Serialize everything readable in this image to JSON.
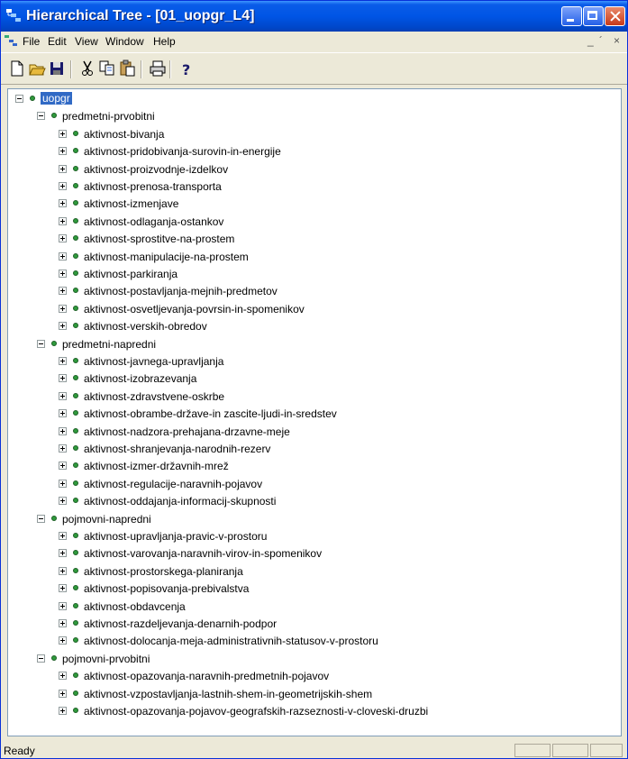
{
  "window": {
    "title": "Hierarchical Tree - [01_uopgr_L4]"
  },
  "menu": [
    "File",
    "Edit",
    "View",
    "Window",
    "Help"
  ],
  "mdi_controls": {
    "min": "_",
    "restore": "´",
    "close": "×"
  },
  "toolbar": [
    {
      "name": "new-icon",
      "icon": "new"
    },
    {
      "name": "open-icon",
      "icon": "open"
    },
    {
      "name": "save-icon",
      "icon": "save"
    },
    {
      "name": "cut-icon",
      "icon": "cut"
    },
    {
      "name": "copy-icon",
      "icon": "copy"
    },
    {
      "name": "paste-icon",
      "icon": "paste"
    },
    {
      "name": "print-icon",
      "icon": "print"
    },
    {
      "name": "help-icon",
      "icon": "help"
    }
  ],
  "tree": {
    "root": "uopgr",
    "groups": [
      {
        "label": "predmetni-prvobitni",
        "children": [
          "aktivnost-bivanja",
          "aktivnost-pridobivanja-surovin-in-energije",
          "aktivnost-proizvodnje-izdelkov",
          "aktivnost-prenosa-transporta",
          "aktivnost-izmenjave",
          "aktivnost-odlaganja-ostankov",
          "aktivnost-sprostitve-na-prostem",
          "aktivnost-manipulacije-na-prostem",
          "aktivnost-parkiranja",
          "aktivnost-postavljanja-mejnih-predmetov",
          "aktivnost-osvetljevanja-povrsin-in-spomenikov",
          "aktivnost-verskih-obredov"
        ]
      },
      {
        "label": "predmetni-napredni",
        "children": [
          "aktivnost-javnega-upravljanja",
          "aktivnost-izobrazevanja",
          "aktivnost-zdravstvene-oskrbe",
          "aktivnost-obrambe-države-in zascite-ljudi-in-sredstev",
          "aktivnost-nadzora-prehajana-drzavne-meje",
          "aktivnost-shranjevanja-narodnih-rezerv",
          "aktivnost-izmer-državnih-mrež",
          "aktivnost-regulacije-naravnih-pojavov",
          "aktivnost-oddajanja-informacij-skupnosti"
        ]
      },
      {
        "label": "pojmovni-napredni",
        "children": [
          "aktivnost-upravljanja-pravic-v-prostoru",
          "aktivnost-varovanja-naravnih-virov-in-spomenikov",
          "aktivnost-prostorskega-planiranja",
          "aktivnost-popisovanja-prebivalstva",
          "aktivnost-obdavcenja",
          "aktivnost-razdeljevanja-denarnih-podpor",
          "aktivnost-dolocanja-meja-administrativnih-statusov-v-prostoru"
        ]
      },
      {
        "label": "pojmovni-prvobitni",
        "children": [
          "aktivnost-opazovanja-naravnih-predmetnih-pojavov",
          "aktivnost-vzpostavljanja-lastnih-shem-in-geometrijskih-shem",
          "aktivnost-opazovanja-pojavov-geografskih-razseznosti-v-cloveski-druzbi"
        ]
      }
    ]
  },
  "status": {
    "text": "Ready"
  },
  "colors": {
    "title_bar": "#0055e5",
    "selection": "#316ac5",
    "node_dot": "#2f9a3c"
  }
}
